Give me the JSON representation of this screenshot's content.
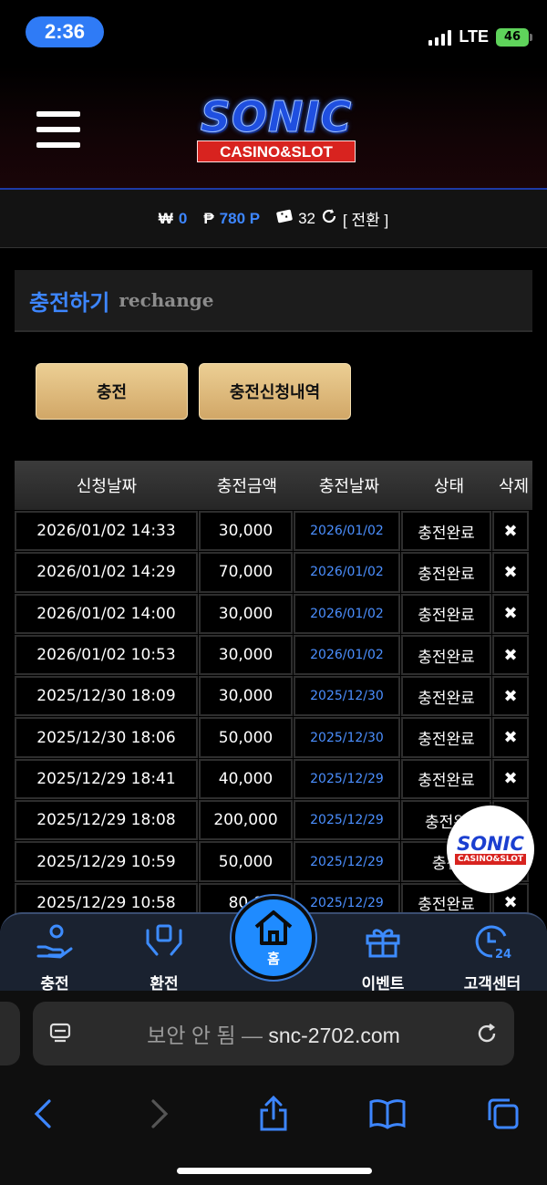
{
  "status_bar": {
    "time": "2:36",
    "network": "LTE",
    "battery": "46"
  },
  "header": {
    "logo_main": "SONIC",
    "logo_sub": "CASINO&SLOT"
  },
  "balance": {
    "won_symbol": "₩",
    "won_value": "0",
    "point_symbol": "₱",
    "point_value": "780 P",
    "coupon_value": "32",
    "convert_label": "[ 전환 ]"
  },
  "section": {
    "title_ko": "충전하기",
    "title_en": "rechange"
  },
  "buttons": {
    "charge": "충전",
    "history": "충전신청내역"
  },
  "table": {
    "columns": [
      "신청날짜",
      "충전금액",
      "충전날짜",
      "상태",
      "삭제"
    ],
    "rows": [
      {
        "requested": "2026/01/02 14:33",
        "amount": "30,000",
        "date": "2026/01/02",
        "status": "충전완료",
        "delete": "✖"
      },
      {
        "requested": "2026/01/02 14:29",
        "amount": "70,000",
        "date": "2026/01/02",
        "status": "충전완료",
        "delete": "✖"
      },
      {
        "requested": "2026/01/02 14:00",
        "amount": "30,000",
        "date": "2026/01/02",
        "status": "충전완료",
        "delete": "✖"
      },
      {
        "requested": "2026/01/02 10:53",
        "amount": "30,000",
        "date": "2026/01/02",
        "status": "충전완료",
        "delete": "✖"
      },
      {
        "requested": "2025/12/30 18:09",
        "amount": "30,000",
        "date": "2025/12/30",
        "status": "충전완료",
        "delete": "✖"
      },
      {
        "requested": "2025/12/30 18:06",
        "amount": "50,000",
        "date": "2025/12/30",
        "status": "충전완료",
        "delete": "✖"
      },
      {
        "requested": "2025/12/29 18:41",
        "amount": "40,000",
        "date": "2025/12/29",
        "status": "충전완료",
        "delete": "✖"
      },
      {
        "requested": "2025/12/29 18:08",
        "amount": "200,000",
        "date": "2025/12/29",
        "status": "충전완",
        "delete": ""
      },
      {
        "requested": "2025/12/29 10:59",
        "amount": "50,000",
        "date": "2025/12/29",
        "status": "충전",
        "delete": ""
      },
      {
        "requested": "2025/12/29 10:58",
        "amount": "80,0",
        "date": "2025/12/29",
        "status": "충전완료",
        "delete": "✖"
      }
    ]
  },
  "floating_logo": {
    "main": "SONIC",
    "sub": "CASINO&SLOT"
  },
  "bottom_nav": {
    "charge": "충전",
    "exchange": "환전",
    "home": "홈",
    "event": "이벤트",
    "support": "고객센터"
  },
  "browser": {
    "insecure_label": "보안 안 됨 —",
    "domain": "snc-2702.com"
  },
  "colors": {
    "accent_blue": "#3d86ff",
    "gold_button": "#e0bd7f",
    "nav_bg": "#1a2230"
  }
}
